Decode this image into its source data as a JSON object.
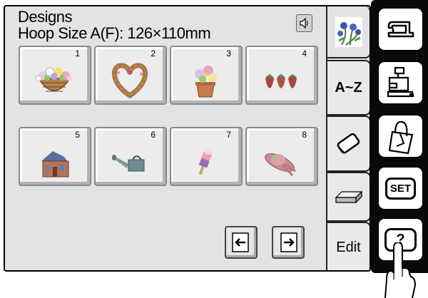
{
  "header": {
    "title": "Designs",
    "hoop_size": "Hoop Size A(F): 126×110mm",
    "sound_icon": "speaker-icon"
  },
  "designs": [
    {
      "number": "1",
      "icon": "flower-basket-icon"
    },
    {
      "number": "2",
      "icon": "heart-wreath-icon"
    },
    {
      "number": "3",
      "icon": "potted-flowers-icon"
    },
    {
      "number": "4",
      "icon": "strawberries-icon"
    },
    {
      "number": "5",
      "icon": "house-icon"
    },
    {
      "number": "6",
      "icon": "watering-can-icon"
    },
    {
      "number": "7",
      "icon": "popsicle-icon"
    },
    {
      "number": "8",
      "icon": "sun-hat-icon"
    }
  ],
  "pager": {
    "prev_icon": "arrow-left-icon",
    "next_icon": "arrow-right-icon"
  },
  "tabs": [
    {
      "id": "designs",
      "icon": "flowers-tab-icon",
      "active": true
    },
    {
      "id": "alphabet",
      "label": "A~Z"
    },
    {
      "id": "eraser",
      "icon": "eraser-icon"
    },
    {
      "id": "block",
      "icon": "block-icon"
    },
    {
      "id": "edit",
      "label": "Edit"
    }
  ],
  "side_buttons": [
    {
      "id": "sewing-machine",
      "icon": "sewing-machine-icon"
    },
    {
      "id": "embroidery-unit",
      "icon": "embroidery-unit-icon"
    },
    {
      "id": "bag",
      "icon": "bag-icon"
    },
    {
      "id": "set",
      "label": "SET"
    },
    {
      "id": "help",
      "label": "?"
    }
  ],
  "colors": {
    "screen_bg": "#e3e3e3",
    "side_panel": "#0a0a0a",
    "tile_bg": "#ececec"
  }
}
